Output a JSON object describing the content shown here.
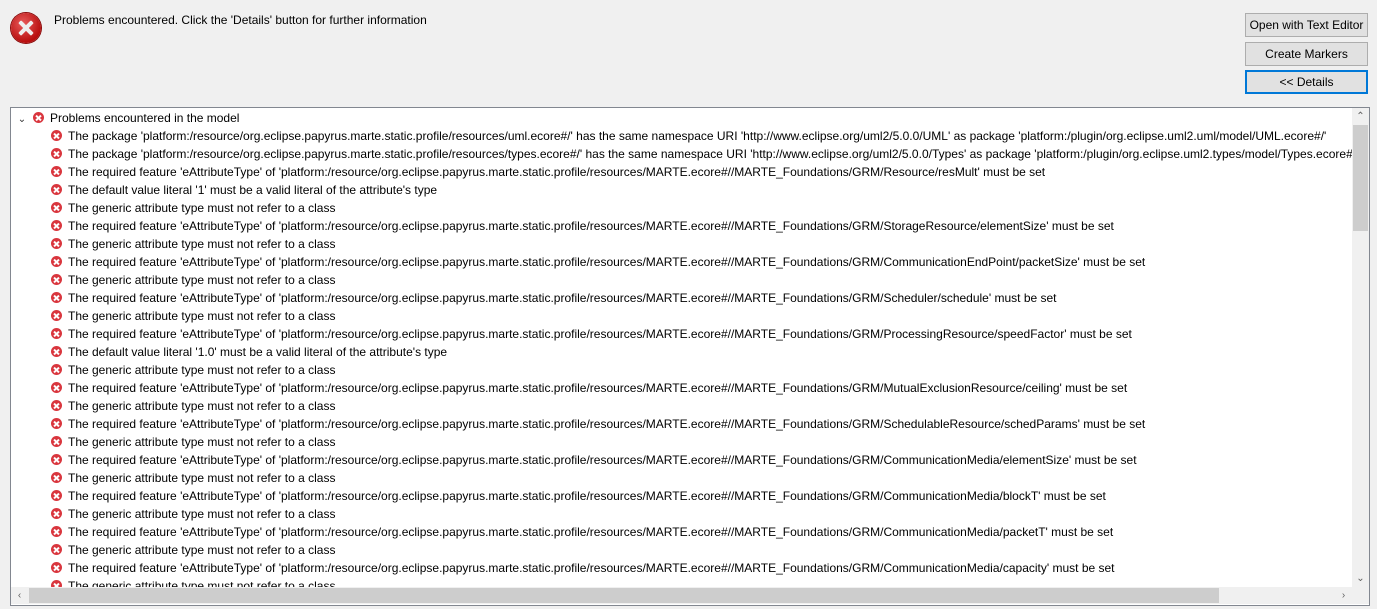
{
  "header": {
    "message": "Problems encountered.  Click the 'Details' button for further information"
  },
  "buttons": {
    "open_text_editor": "Open with Text Editor",
    "create_markers": "Create Markers",
    "details": "<< Details"
  },
  "tree": {
    "root": "Problems encountered in the model",
    "items": [
      "The package 'platform:/resource/org.eclipse.papyrus.marte.static.profile/resources/uml.ecore#/' has the same namespace URI 'http://www.eclipse.org/uml2/5.0.0/UML' as package 'platform:/plugin/org.eclipse.uml2.uml/model/UML.ecore#/'",
      "The package 'platform:/resource/org.eclipse.papyrus.marte.static.profile/resources/types.ecore#/' has the same namespace URI 'http://www.eclipse.org/uml2/5.0.0/Types' as package 'platform:/plugin/org.eclipse.uml2.types/model/Types.ecore#/'",
      "The required feature 'eAttributeType' of 'platform:/resource/org.eclipse.papyrus.marte.static.profile/resources/MARTE.ecore#//MARTE_Foundations/GRM/Resource/resMult' must be set",
      "The default value literal '1' must be a valid literal of the attribute's type",
      "The generic attribute type must not refer to a class",
      "The required feature 'eAttributeType' of 'platform:/resource/org.eclipse.papyrus.marte.static.profile/resources/MARTE.ecore#//MARTE_Foundations/GRM/StorageResource/elementSize' must be set",
      "The generic attribute type must not refer to a class",
      "The required feature 'eAttributeType' of 'platform:/resource/org.eclipse.papyrus.marte.static.profile/resources/MARTE.ecore#//MARTE_Foundations/GRM/CommunicationEndPoint/packetSize' must be set",
      "The generic attribute type must not refer to a class",
      "The required feature 'eAttributeType' of 'platform:/resource/org.eclipse.papyrus.marte.static.profile/resources/MARTE.ecore#//MARTE_Foundations/GRM/Scheduler/schedule' must be set",
      "The generic attribute type must not refer to a class",
      "The required feature 'eAttributeType' of 'platform:/resource/org.eclipse.papyrus.marte.static.profile/resources/MARTE.ecore#//MARTE_Foundations/GRM/ProcessingResource/speedFactor' must be set",
      "The default value literal '1.0' must be a valid literal of the attribute's type",
      "The generic attribute type must not refer to a class",
      "The required feature 'eAttributeType' of 'platform:/resource/org.eclipse.papyrus.marte.static.profile/resources/MARTE.ecore#//MARTE_Foundations/GRM/MutualExclusionResource/ceiling' must be set",
      "The generic attribute type must not refer to a class",
      "The required feature 'eAttributeType' of 'platform:/resource/org.eclipse.papyrus.marte.static.profile/resources/MARTE.ecore#//MARTE_Foundations/GRM/SchedulableResource/schedParams' must be set",
      "The generic attribute type must not refer to a class",
      "The required feature 'eAttributeType' of 'platform:/resource/org.eclipse.papyrus.marte.static.profile/resources/MARTE.ecore#//MARTE_Foundations/GRM/CommunicationMedia/elementSize' must be set",
      "The generic attribute type must not refer to a class",
      "The required feature 'eAttributeType' of 'platform:/resource/org.eclipse.papyrus.marte.static.profile/resources/MARTE.ecore#//MARTE_Foundations/GRM/CommunicationMedia/blockT' must be set",
      "The generic attribute type must not refer to a class",
      "The required feature 'eAttributeType' of 'platform:/resource/org.eclipse.papyrus.marte.static.profile/resources/MARTE.ecore#//MARTE_Foundations/GRM/CommunicationMedia/packetT' must be set",
      "The generic attribute type must not refer to a class",
      "The required feature 'eAttributeType' of 'platform:/resource/org.eclipse.papyrus.marte.static.profile/resources/MARTE.ecore#//MARTE_Foundations/GRM/CommunicationMedia/capacity' must be set",
      "The generic attribute type must not refer to a class"
    ]
  }
}
